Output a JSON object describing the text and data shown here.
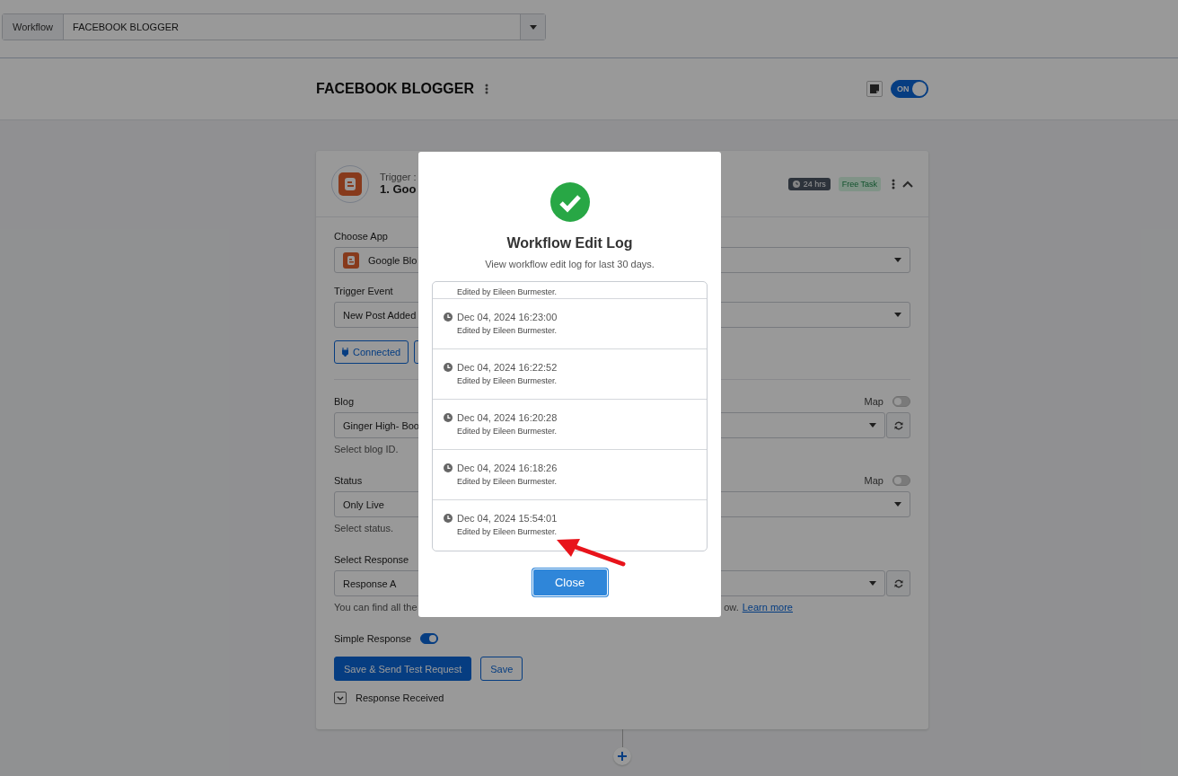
{
  "workflow_select": {
    "label": "Workflow",
    "value": "FACEBOOK BLOGGER"
  },
  "header": {
    "title": "FACEBOOK BLOGGER",
    "toggle": {
      "label": "ON",
      "on": true
    }
  },
  "step": {
    "subtitle": "Trigger : ",
    "title": "1. Goo",
    "duration": "24 hrs",
    "badge": "Free Task",
    "expanded": true,
    "fields": [
      {
        "kind": "select",
        "label": "Choose App",
        "value": "Google Blo",
        "app_icon": true
      },
      {
        "kind": "select",
        "label": "Trigger Event",
        "value": "New Post Added"
      },
      {
        "kind": "connect",
        "label": "Connected"
      },
      {
        "kind": "select",
        "label": "Blog",
        "value": "Ginger High- Boo",
        "map": {
          "label": "Map",
          "on": false
        },
        "refresh": true,
        "help": "Select blog ID."
      },
      {
        "kind": "select",
        "label": "Status",
        "value": "Only Live",
        "map": {
          "label": "Map",
          "on": false
        },
        "help": "Select status."
      },
      {
        "kind": "select",
        "label": "Select Response",
        "value": "Response A",
        "refresh": true,
        "help": "You can find all the",
        "help_tail": "ow.",
        "link": "Learn more"
      },
      {
        "kind": "switch",
        "label": "Simple Response",
        "on": true
      }
    ],
    "buttons": [
      {
        "label": "Save & Send Test Request",
        "primary": true
      },
      {
        "label": "Save",
        "primary": false
      }
    ],
    "response": {
      "label": "Response Received",
      "expanded": false
    }
  },
  "dialog": {
    "title": "Workflow Edit Log",
    "subtitle": "View workflow edit log for last 30 days.",
    "entries": [
      {
        "note": "Edited by Eileen Burmester."
      },
      {
        "time": "Dec 04, 2024 16:23:00",
        "note": "Edited by Eileen Burmester."
      },
      {
        "time": "Dec 04, 2024 16:22:52",
        "note": "Edited by Eileen Burmester."
      },
      {
        "time": "Dec 04, 2024 16:20:28",
        "note": "Edited by Eileen Burmester."
      },
      {
        "time": "Dec 04, 2024 16:18:26",
        "note": "Edited by Eileen Burmester."
      },
      {
        "time": "Dec 04, 2024 15:54:01",
        "note": "Edited by Eileen Burmester."
      }
    ],
    "close": "Close"
  }
}
